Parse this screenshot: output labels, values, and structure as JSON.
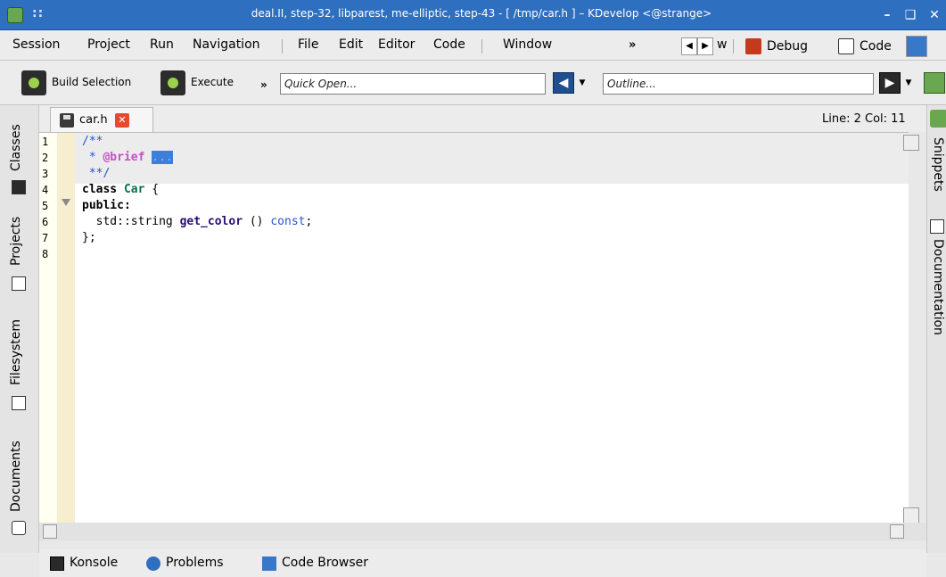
{
  "window": {
    "title": "deal.II, step-32, libparest, me-elliptic, step-43 - [ /tmp/car.h ] – KDevelop <@strange>",
    "grip": "::",
    "min": "–",
    "max": "❑",
    "close": "✕"
  },
  "menu": {
    "items": [
      "Session",
      "Project",
      "Run",
      "Navigation",
      "File",
      "Edit",
      "Editor",
      "Code",
      "Window"
    ],
    "more": "»",
    "review_partial": "w",
    "debug": "Debug",
    "code": "Code"
  },
  "toolbar": {
    "build_selection": "Build Selection",
    "execute": "Execute",
    "more": "»",
    "quick_open_placeholder": "Quick Open...",
    "outline_placeholder": "Outline..."
  },
  "left_dock": {
    "tabs": [
      "Classes",
      "Projects",
      "Filesystem",
      "Documents"
    ]
  },
  "right_dock": {
    "tabs": [
      "Snippets",
      "Documentation"
    ]
  },
  "editor_tab": {
    "filename": "car.h",
    "cursor_position": "Line: 2 Col: 11"
  },
  "code": {
    "line_numbers": [
      "1",
      "2",
      "3",
      "4",
      "5",
      "6",
      "7",
      "8"
    ],
    "line1": "/**",
    "line2_prefix": " * ",
    "line2_tag": "@brief",
    "line2_space": " ",
    "line2_sel": "...",
    "line3": " **/",
    "line4_kw": "class",
    "line4_name": "Car",
    "line4_rest": " {",
    "line5": "public:",
    "line6_pre": "  std::string ",
    "line6_fn": "get_color",
    "line6_mid": " () ",
    "line6_const": "const",
    "line6_end": ";",
    "line7": "};"
  },
  "status": {
    "konsole": "Konsole",
    "problems": "Problems",
    "code_browser": "Code Browser"
  },
  "colors": {
    "titlebar": "#2f6fbf",
    "comment": "#1d56c8",
    "doc_tag": "#c64ecb",
    "selection": "#3d7edb",
    "type": "#0d6f4e",
    "function": "#2a0d73"
  }
}
